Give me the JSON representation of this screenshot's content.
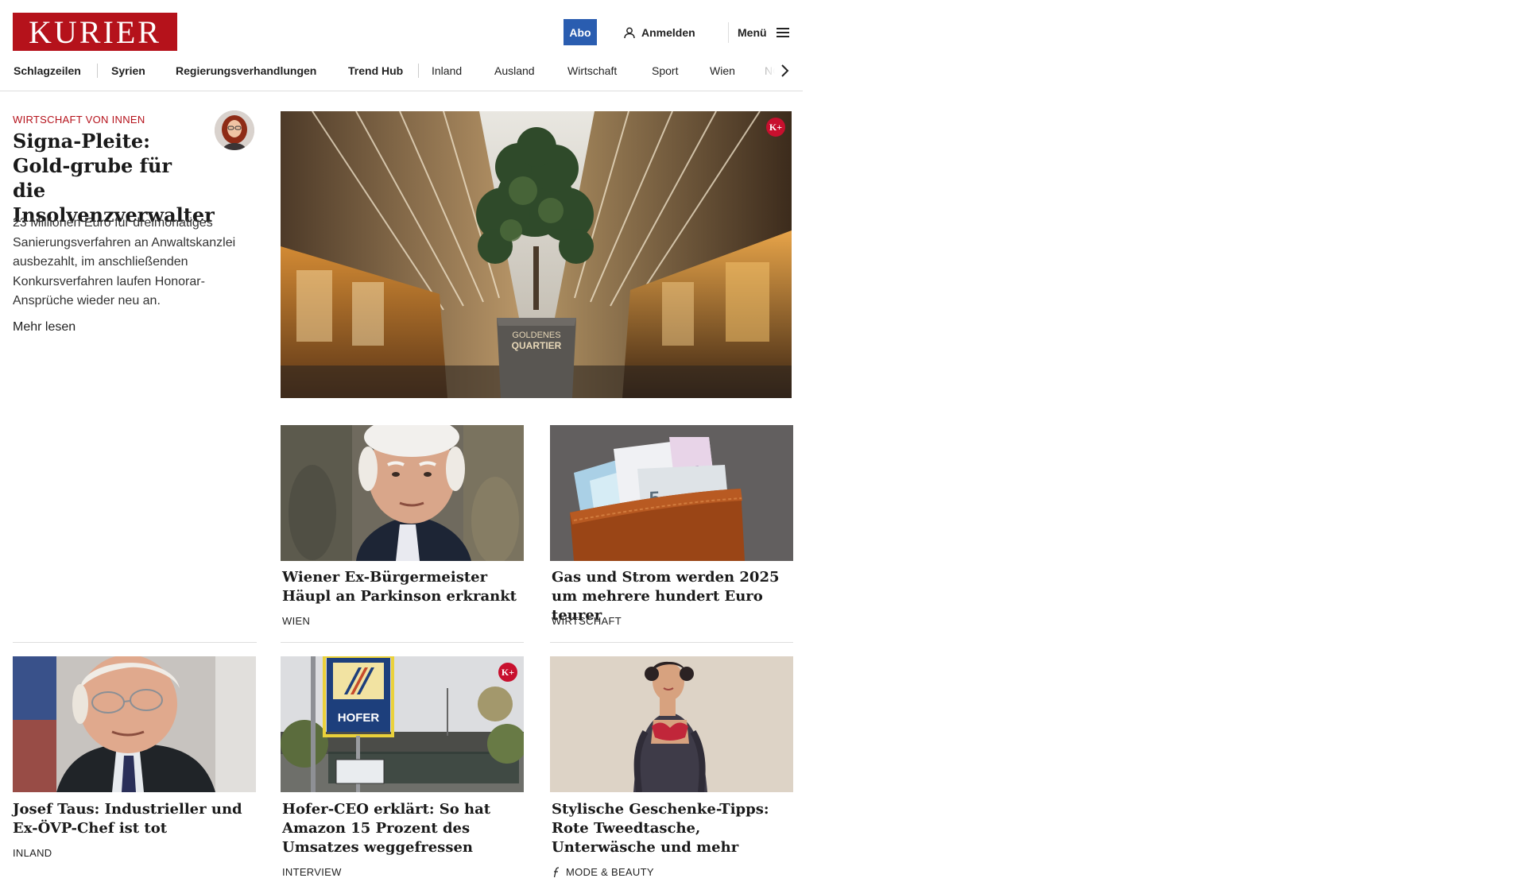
{
  "header": {
    "logo_text": "KURIER",
    "abo_label": "Abo",
    "login_label": "Anmelden",
    "menu_label": "Menü"
  },
  "nav": {
    "items": [
      "Schlagzeilen",
      "Syrien",
      "Regierungsverhandlungen",
      "Trend Hub",
      "Inland",
      "Ausland",
      "Wirtschaft",
      "Sport",
      "Wien",
      "NÖ"
    ]
  },
  "lead": {
    "kicker": "WIRTSCHAFT VON INNEN",
    "title": "Signa-Pleite: Gold-grube für die Insolvenzverwalter",
    "teaser": "23 Millionen Euro für dreimonatiges Sanierungsverfahren an Anwaltskanzlei ausbezahlt, im anschließenden Konkursverfahren laufen Honorar-Ansprüche wieder neu an.",
    "more_label": "Mehr lesen",
    "image_sign_line1": "GOLDENES",
    "image_sign_line2": "QUARTIER",
    "kplus_label": "K+"
  },
  "cards": [
    {
      "title": "Wiener Ex-Bürgermeister Häupl an Parkinson erkrankt",
      "category": "WIEN"
    },
    {
      "title": "Gas und Strom werden 2025 um mehrere hundert Euro teurer",
      "category": "WIRTSCHAFT"
    },
    {
      "title": "Josef Taus: Industrieller und Ex-ÖVP-Chef ist tot",
      "category": "INLAND"
    },
    {
      "title": "Hofer-CEO erklärt: So hat Amazon 15 Prozent des Umsatzes weggefressen",
      "category": "INTERVIEW",
      "kplus_label": "K+",
      "image_sign": "HOFER"
    },
    {
      "title": "Stylische Geschenke-Tipps: Rote Tweedtasche, Unterwäsche und mehr",
      "category": "MODE & BEAUTY"
    }
  ],
  "colors": {
    "brand_red": "#b5121b",
    "abo_blue": "#2a5db0",
    "kplus_red": "#c8102e"
  },
  "icons": [
    "user-icon",
    "hamburger-icon",
    "chevron-right-icon",
    "kplus-badge",
    "style-f-icon"
  ]
}
